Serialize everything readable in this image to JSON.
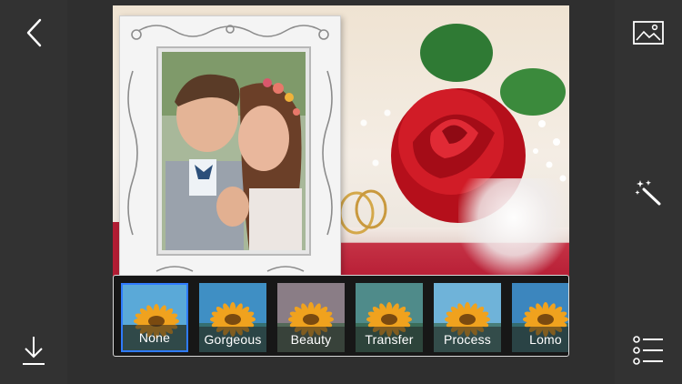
{
  "toolbar": {
    "back_icon": "chevron-left-icon",
    "download_icon": "download-icon",
    "gallery_icon": "image-gallery-icon",
    "magic_icon": "magic-wand-icon",
    "menu_icon": "list-menu-icon"
  },
  "filters": [
    {
      "label": "None",
      "selected": true,
      "tint": "#5aa9d8"
    },
    {
      "label": "Gorgeous",
      "selected": false,
      "tint": "#3f8fc4"
    },
    {
      "label": "Beauty",
      "selected": false,
      "tint": "#8a7d86"
    },
    {
      "label": "Transfer",
      "selected": false,
      "tint": "#4f8b8a"
    },
    {
      "label": "Process",
      "selected": false,
      "tint": "#6fb3d9"
    },
    {
      "label": "Lomo",
      "selected": false,
      "tint": "#3c86be"
    }
  ],
  "colors": {
    "accent": "#2f7bff",
    "sidebar": "#323232",
    "rose": "#c4141f"
  }
}
